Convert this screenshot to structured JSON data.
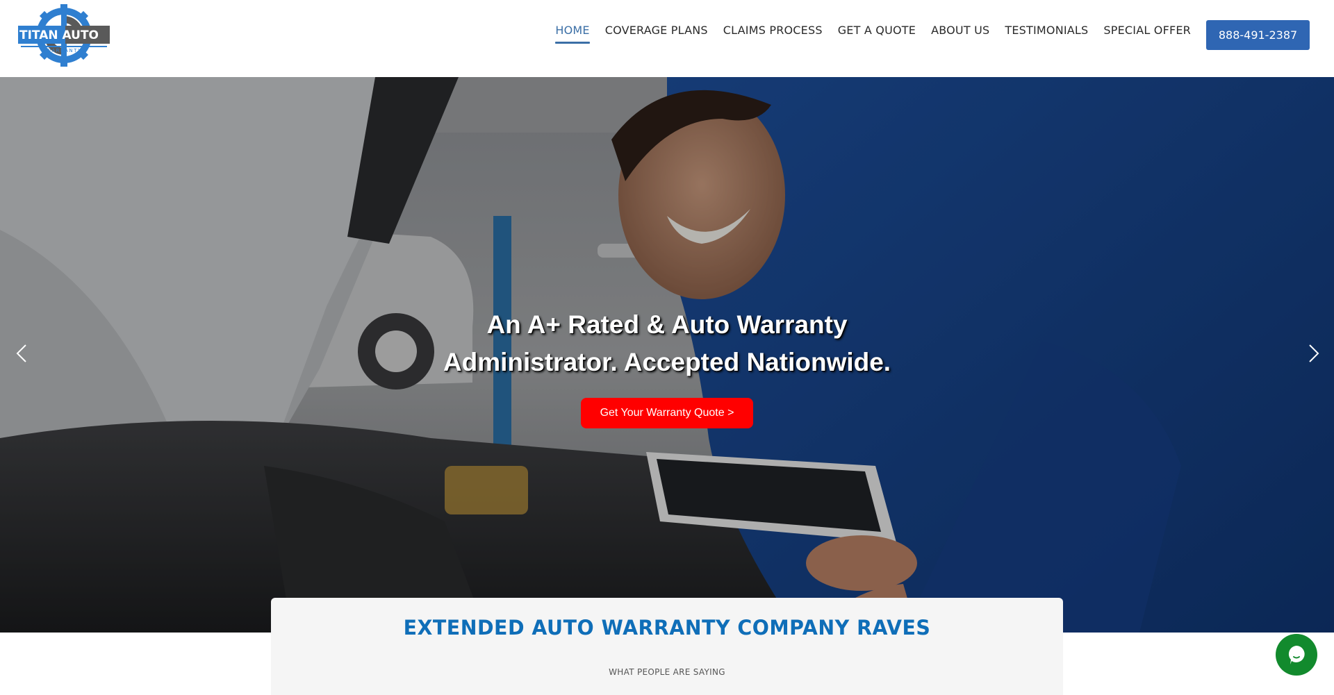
{
  "brand": {
    "logo_line1": "TITAN AUTO",
    "logo_line2": "WARRANTY",
    "primary_color": "#2f66b3",
    "cta_color": "#ff0000",
    "heading_color": "#0f6eb8"
  },
  "nav": {
    "items": [
      {
        "label": "HOME",
        "active": true
      },
      {
        "label": "COVERAGE PLANS",
        "active": false
      },
      {
        "label": "CLAIMS PROCESS",
        "active": false
      },
      {
        "label": "GET A QUOTE",
        "active": false
      },
      {
        "label": "ABOUT US",
        "active": false
      },
      {
        "label": "TESTIMONIALS",
        "active": false
      },
      {
        "label": "SPECIAL OFFER",
        "active": false
      }
    ],
    "phone": "888-491-2387"
  },
  "hero": {
    "title_line1": "An A+ Rated & Auto Warranty",
    "title_line2": "Administrator. Accepted Nationwide.",
    "cta_label": "Get Your Warranty Quote >",
    "prev_icon": "chevron-left-icon",
    "next_icon": "chevron-right-icon"
  },
  "raves": {
    "title": "EXTENDED AUTO WARRANTY COMPANY RAVES",
    "subtitle": "WHAT PEOPLE ARE SAYING"
  },
  "chat": {
    "icon": "chat-bubble-icon"
  }
}
